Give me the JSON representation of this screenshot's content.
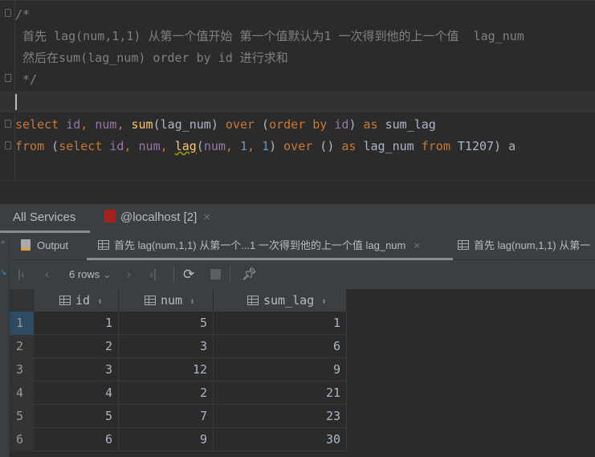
{
  "editor": {
    "comment": [
      "/*",
      " 首先 lag(num,1,1) 从第一个值开始 第一个值默认为1 一次得到他的上一个值  lag_num",
      " 然后在sum(lag_num) order by id 进行求和",
      " */"
    ],
    "line1": [
      "select",
      " id",
      ", ",
      "num",
      ", ",
      "sum",
      "(lag_num) ",
      "over",
      " (",
      "order by",
      " ",
      "id",
      ") ",
      "as",
      " sum_lag"
    ],
    "line2": [
      "from",
      " (",
      "select",
      " ",
      "id",
      ", ",
      "num",
      ", ",
      "lag",
      "(",
      "num",
      ", ",
      "1",
      ", ",
      "1",
      ") ",
      "over",
      " () ",
      "as",
      " lag_num ",
      "from",
      " T1207) a"
    ]
  },
  "panel": {
    "all_services": "All Services",
    "connection": "@localhost [2]",
    "tabs": [
      "Output",
      "首先 lag(num,1,1) 从第一个...1 一次得到他的上一个值  lag_num",
      "首先 lag(num,1,1) 从第一"
    ],
    "rows_label": "6 rows"
  },
  "table": {
    "columns": [
      "id",
      "num",
      "sum_lag"
    ],
    "rows": [
      [
        "1",
        "5",
        "1"
      ],
      [
        "2",
        "3",
        "6"
      ],
      [
        "3",
        "12",
        "9"
      ],
      [
        "4",
        "2",
        "21"
      ],
      [
        "5",
        "7",
        "23"
      ],
      [
        "6",
        "9",
        "30"
      ]
    ]
  }
}
